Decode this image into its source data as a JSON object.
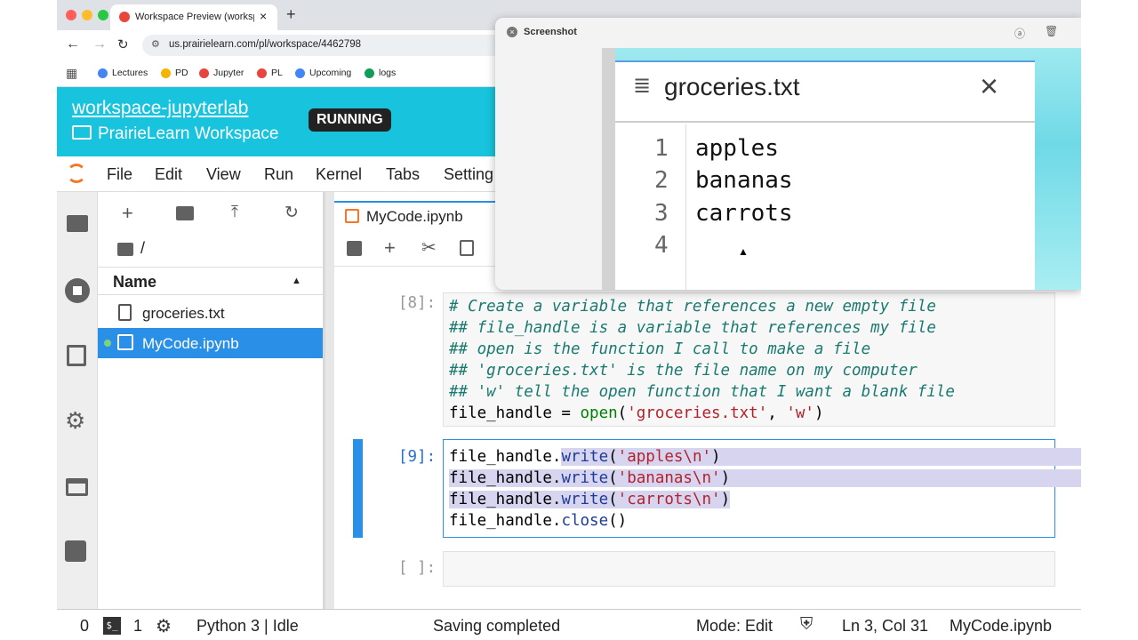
{
  "browser": {
    "tab_title": "Workspace Preview (worksp",
    "url": "us.prairielearn.com/pl/workspace/4462798",
    "bookmarks": [
      {
        "label": "Lectures",
        "color": "#4285f4"
      },
      {
        "label": "PD",
        "color": "#f4b400"
      },
      {
        "label": "Jupyter",
        "color": "#e8453c"
      },
      {
        "label": "PL",
        "color": "#e8453c"
      },
      {
        "label": "Upcoming",
        "color": "#4285f4"
      },
      {
        "label": "logs",
        "color": "#0f9d58"
      }
    ]
  },
  "workspace": {
    "name": "workspace-jupyterlab",
    "subtitle": "PrairieLearn Workspace",
    "status": "RUNNING"
  },
  "menu": [
    "File",
    "Edit",
    "View",
    "Run",
    "Kernel",
    "Tabs",
    "Setting"
  ],
  "filebrowser": {
    "path": "/",
    "column_header": "Name",
    "files": [
      {
        "name": "groceries.txt",
        "selected": false
      },
      {
        "name": "MyCode.ipynb",
        "selected": true
      }
    ]
  },
  "notebook": {
    "tab_label": "MyCode.ipynb",
    "cells": [
      {
        "prompt": "[8]:"
      },
      {
        "prompt": "[9]:"
      },
      {
        "prompt": "[ ]:"
      }
    ]
  },
  "status": {
    "terminals": "0",
    "kernels": "1",
    "kernel": "Python 3 | Idle",
    "message": "Saving completed",
    "mode": "Mode: Edit",
    "position": "Ln 3, Col 31",
    "file": "MyCode.ipynb"
  },
  "screenshot": {
    "title": "Screenshot",
    "file_title": "groceries.txt",
    "lines": [
      {
        "n": "1",
        "text": "apples"
      },
      {
        "n": "2",
        "text": "bananas"
      },
      {
        "n": "3",
        "text": "carrots"
      },
      {
        "n": "4",
        "text": ""
      }
    ]
  }
}
